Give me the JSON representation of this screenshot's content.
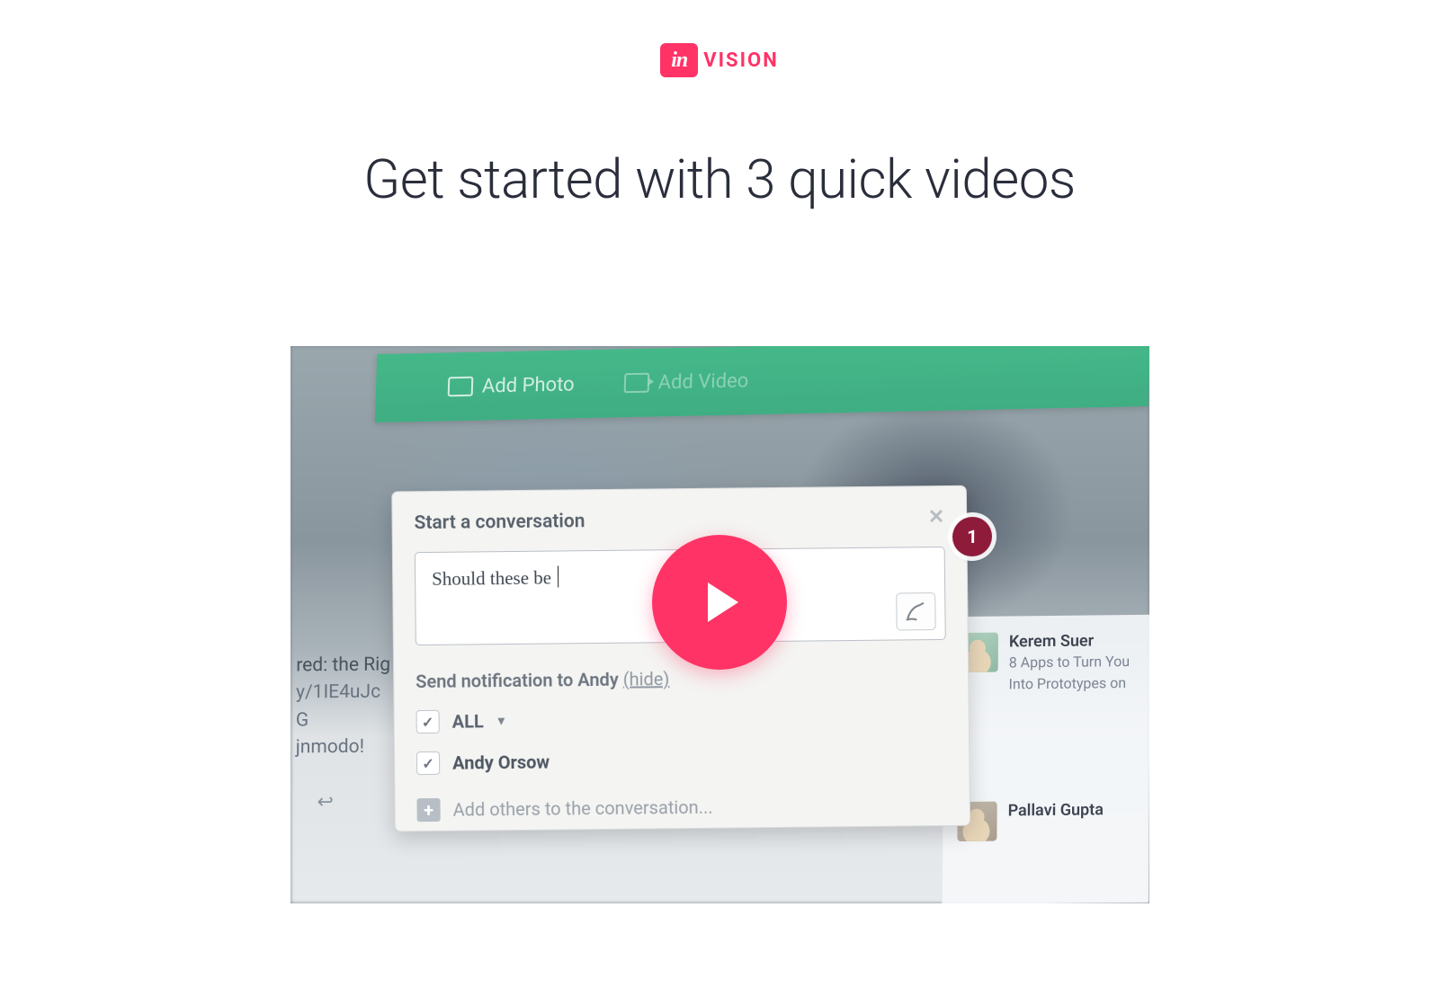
{
  "brand": {
    "badge": "in",
    "wordmark": "VISION",
    "accent": "#ff3366"
  },
  "headline": "Get started with 3 quick videos",
  "video_thumb": {
    "toolbar": {
      "add_photo": "Add Photo",
      "add_video": "Add Video"
    },
    "popover": {
      "title": "Start a conversation",
      "input_text": "Should these be ",
      "notify_prefix": "Send notification to Andy ",
      "notify_hide": "(hide)",
      "all_label": "ALL",
      "recipient": "Andy Orsow",
      "add_others": "Add others to the conversation..."
    },
    "marker": "1",
    "left_snippet": {
      "l1": "red: the Rig",
      "l2": "y/1IE4uJc G",
      "l3": "jnmodo!"
    },
    "activity": [
      {
        "name": "Kerem Suer",
        "desc_line1": "8 Apps to Turn You",
        "desc_line2": "Into Prototypes on"
      },
      {
        "name": "Pallavi Gupta",
        "desc_line1": "",
        "desc_line2": ""
      }
    ]
  }
}
